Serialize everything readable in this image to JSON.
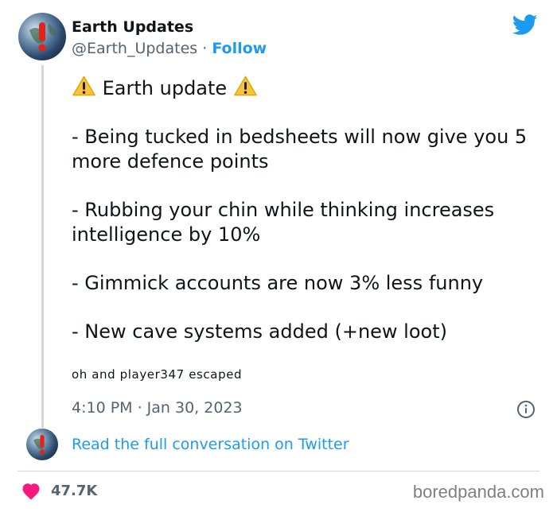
{
  "author": {
    "name": "Earth Updates",
    "handle": "@Earth_Updates",
    "separator": "·",
    "follow_label": "Follow",
    "avatar_icon": "earth-warning-avatar-icon"
  },
  "tweet": {
    "heading": "Earth update",
    "lines": [
      "- Being tucked in bedsheets will now give you 5 more defence points",
      "- Rubbing your chin while thinking increases intelligence by 10%",
      "- Gimmick accounts are now 3% less funny",
      "- New cave systems added (+new loot)"
    ],
    "tagline": "oh and player347 escaped",
    "timestamp": "4:10 PM · Jan 30, 2023"
  },
  "footer": {
    "read_link": "Read the full conversation on Twitter",
    "likes": "47.7K",
    "watermark": "boredpanda.com"
  },
  "colors": {
    "accent": "#1d9bf0",
    "heart": "#f91880",
    "warning": "#f6c343",
    "muted": "#536471"
  }
}
